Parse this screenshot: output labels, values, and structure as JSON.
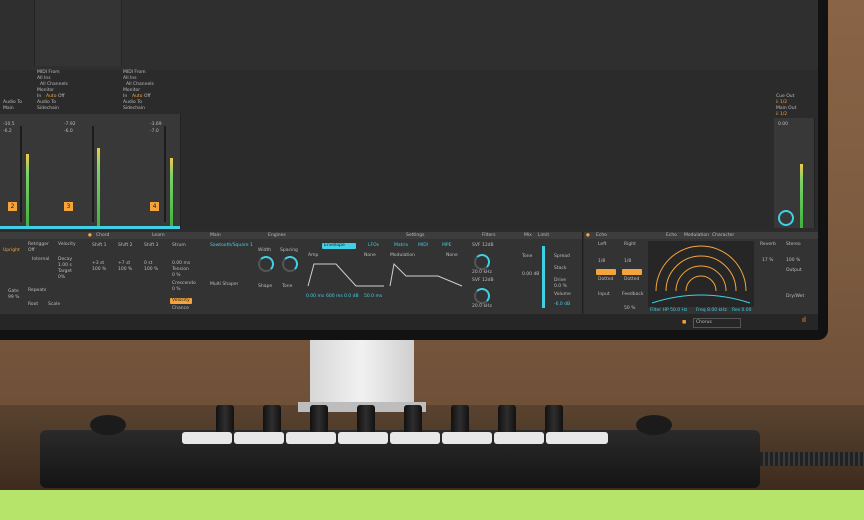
{
  "colors": {
    "accent_orange": "#f5a43b",
    "accent_cyan": "#3fd0e6",
    "meter_green": "#3db33d",
    "floor": "#b6e36a"
  },
  "mixer": {
    "midi_from": "MIDI From",
    "all_ins": "All Ins",
    "all_channels": "All Channels",
    "monitor": "Monitor",
    "monitor_in": "In",
    "monitor_auto": "Auto",
    "monitor_off": "Off",
    "audio_to": "Audio To",
    "sidechain": "Sidechain",
    "main": "Main",
    "tracks": [
      {
        "number": "2",
        "vol": "-10.5",
        "peak": "-6.2",
        "level": 0.66
      },
      {
        "number": "3",
        "vol": "-7.92",
        "peak": "-6.0",
        "level": 0.72
      },
      {
        "number": "4",
        "vol": "-3.69",
        "peak": "-7.0",
        "level": 0.61
      }
    ],
    "cue_out": "Cue Out",
    "cue_sel": "ii 1/2",
    "main_out": "Main Out",
    "main_sel": "ii 1/2",
    "master_vol": "0.00",
    "master_level": 0.58
  },
  "devices": {
    "chord": {
      "title": "Chord",
      "learn": "Learn",
      "shifts": [
        "Shift 1",
        "Shift 2",
        "Shift 3"
      ],
      "vals": [
        "+3 st",
        "+7 st",
        "0 st"
      ],
      "pct": [
        "100 %",
        "100 %",
        "100 %"
      ],
      "strum": "Strum",
      "strum_val": "0.00 ms",
      "tension": "Tension",
      "tension_val": "0 %",
      "crescendo": "Crescendo",
      "crescendo_val": "0 %",
      "velocity": "Velocity",
      "chance": "Chance"
    },
    "arp": {
      "retrigger": "Retrigger",
      "velocity": "Velocity",
      "off": "Off",
      "rate": "Rate",
      "rate_val": "Internal",
      "decay": "Decay",
      "decay_val": "1.00 s",
      "target": "Target",
      "target_val": "0%",
      "repeats": "Repeats",
      "root": "Root",
      "scale": "Scale",
      "style": "Upright",
      "gate": "Gate",
      "gate_val": "99 %"
    },
    "drift": {
      "title": "Main",
      "engines": "Engines",
      "osc1": "Sawtooth/Square 1",
      "osc2": "Multi Shaper",
      "spacing": "Spacing",
      "width": "Width",
      "shape": "Shape",
      "tone": "Tone",
      "env": "Envelope",
      "lfos": "LFOs",
      "matrix": "Matrix",
      "mod_label": "Modulation",
      "midi": "MIDI",
      "mpe": "MPE",
      "settings": "Settings",
      "amp": "Amp",
      "none": "None",
      "filters": "Filters",
      "svf1": "SVF 12dB",
      "svf2": "SVF 12dB",
      "freq1": "20.0 kHz",
      "freq2": "20.0 kHz",
      "attack": "0.00 ms",
      "decay": "600 ms",
      "sustain": "0.0 dB",
      "release": "50.0 ms",
      "mix": "Mix",
      "limit": "Limit",
      "gain_val": "0.00 dB",
      "tone_label": "Tone",
      "drive": "Drive",
      "drive_val": "0.0 %",
      "volume": "Volume",
      "volume_val": "-6.0 dB",
      "spread": "Spread",
      "stack": "Stack"
    },
    "echo": {
      "title": "Echo",
      "echo_tab": "Echo",
      "modulation_tab": "Modulation",
      "character_tab": "Character",
      "left": "Left",
      "right": "Right",
      "l_val": "1/8",
      "r_val": "1/8",
      "sync": "Sync",
      "dotted": "Dotted",
      "input": "Input",
      "feedback": "Feedback",
      "reverb": "Reverb",
      "stereo": "Stereo",
      "output": "Output",
      "dry_wet": "Dry/Wet",
      "pct1": "17 %",
      "pct2": "100 %",
      "fb_val": "50 %",
      "filter_hp": "Filter HP 50.0 Hz",
      "freq_lp": "Freq 8.00 kHz",
      "res": "Res 0.00"
    }
  },
  "statusbar": {
    "chorus": "Chorus",
    "brand_icon": "waveform-icon"
  },
  "controller": {
    "pads": 8,
    "knobs": 8
  }
}
